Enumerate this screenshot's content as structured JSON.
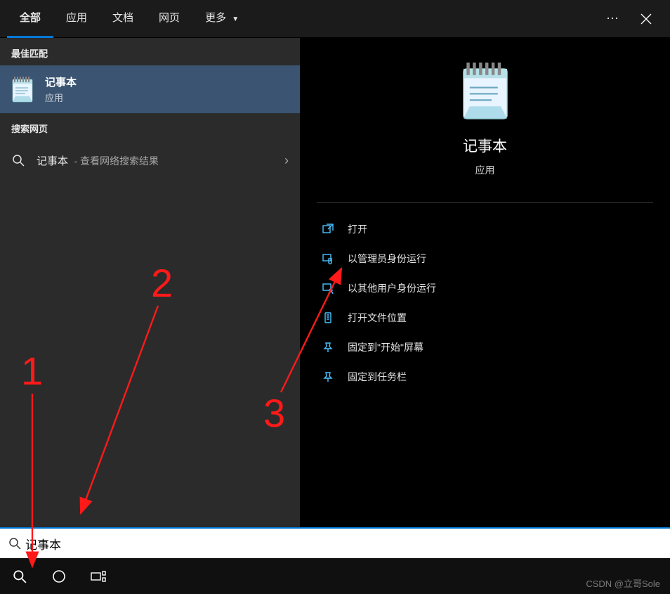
{
  "tabs": {
    "all": "全部",
    "apps": "应用",
    "docs": "文档",
    "web": "网页",
    "more": "更多"
  },
  "left": {
    "best_match_header": "最佳匹配",
    "result": {
      "title": "记事本",
      "subtitle": "应用"
    },
    "search_web_header": "搜索网页",
    "web_query": "记事本",
    "web_hint": "- 查看网络搜索结果"
  },
  "detail": {
    "name": "记事本",
    "type": "应用",
    "actions": {
      "open": "打开",
      "run_admin": "以管理员身份运行",
      "run_other_user": "以其他用户身份运行",
      "open_location": "打开文件位置",
      "pin_start": "固定到\"开始\"屏幕",
      "pin_taskbar": "固定到任务栏"
    }
  },
  "searchbox": {
    "value": "记事本"
  },
  "annotations": {
    "one": "1",
    "two": "2",
    "three": "3"
  },
  "watermark": "CSDN @立哥Sole"
}
